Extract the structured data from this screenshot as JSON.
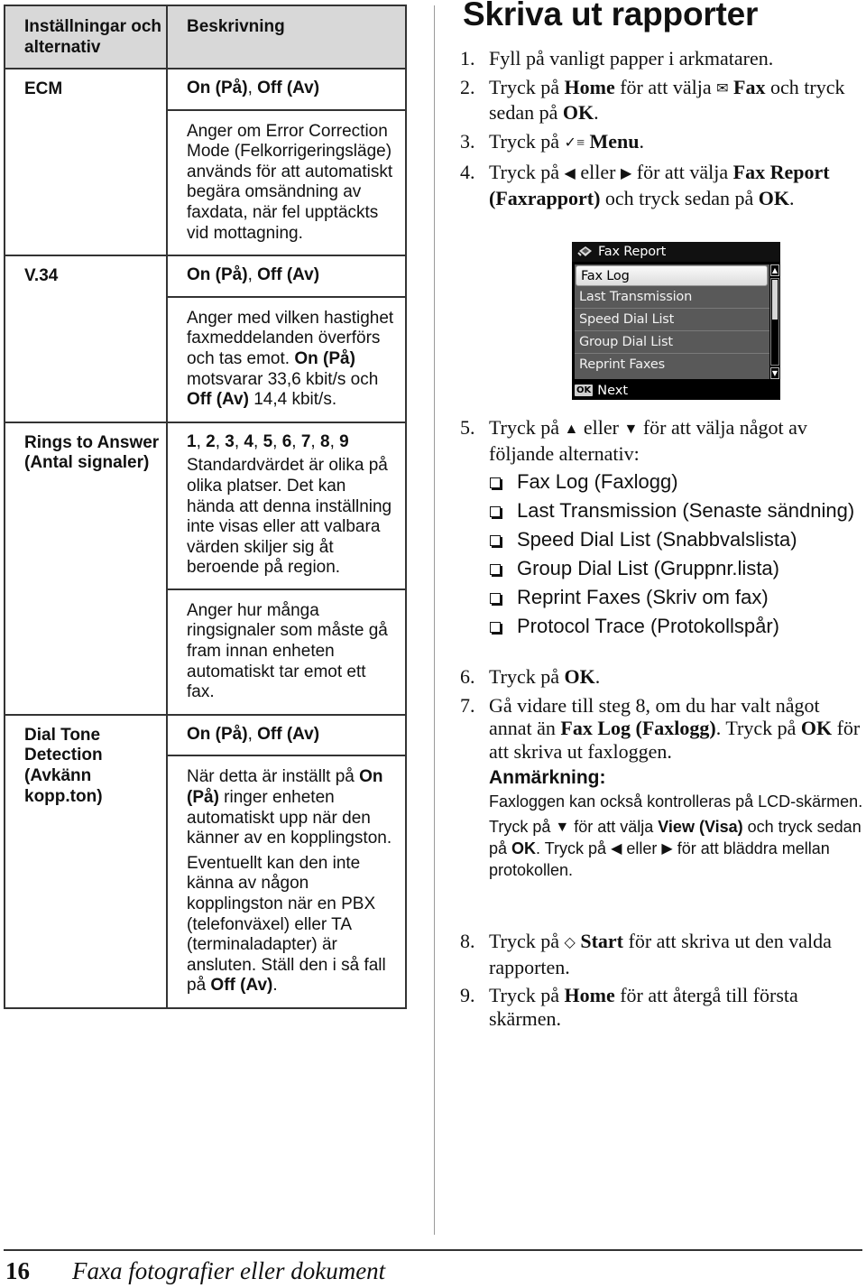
{
  "table": {
    "headers": [
      "Inställningar och alternativ",
      "Beskrivning"
    ],
    "rows": [
      {
        "setting": "ECM",
        "values_parts": [
          {
            "text": "On (På)",
            "bold": true
          },
          {
            "text": ", ",
            "bold": false
          },
          {
            "text": "Off (Av)",
            "bold": true
          }
        ],
        "description": [
          [
            {
              "text": "Anger om Error Correction Mode (Felkorrigeringsläge) används för att automatiskt begära omsändning av faxdata, när fel upptäckts vid mottagning.",
              "bold": false
            }
          ]
        ]
      },
      {
        "setting": "V.34",
        "values_parts": [
          {
            "text": "On (På)",
            "bold": true
          },
          {
            "text": ", ",
            "bold": false
          },
          {
            "text": "Off (Av)",
            "bold": true
          }
        ],
        "description": [
          [
            {
              "text": "Anger med vilken hastighet faxmeddelanden överförs och tas emot. ",
              "bold": false
            },
            {
              "text": "On (På)",
              "bold": true
            },
            {
              "text": " motsvarar 33,6 kbit/s och ",
              "bold": false
            },
            {
              "text": "Off (Av)",
              "bold": true
            },
            {
              "text": " 14,4 kbit/s.",
              "bold": false
            }
          ]
        ]
      },
      {
        "setting": "Rings to Answer (Antal signaler)",
        "values_parts": [
          {
            "text": "1",
            "bold": true
          },
          {
            "text": ", ",
            "bold": false
          },
          {
            "text": "2",
            "bold": true
          },
          {
            "text": ", ",
            "bold": false
          },
          {
            "text": "3",
            "bold": true
          },
          {
            "text": ", ",
            "bold": false
          },
          {
            "text": "4",
            "bold": true
          },
          {
            "text": ", ",
            "bold": false
          },
          {
            "text": "5",
            "bold": true
          },
          {
            "text": ", ",
            "bold": false
          },
          {
            "text": "6",
            "bold": true
          },
          {
            "text": ", ",
            "bold": false
          },
          {
            "text": "7",
            "bold": true
          },
          {
            "text": ", ",
            "bold": false
          },
          {
            "text": "8",
            "bold": true
          },
          {
            "text": ", ",
            "bold": false
          },
          {
            "text": "9",
            "bold": true
          }
        ],
        "values_note": "Standardvärdet är olika på olika platser. Det kan hända att denna inställning inte visas eller att valbara värden skiljer sig åt beroende på region.",
        "description": [
          [
            {
              "text": "Anger hur många ringsignaler som måste gå fram innan enheten automatiskt tar emot ett fax.",
              "bold": false
            }
          ]
        ]
      },
      {
        "setting": "Dial Tone Detection (Avkänn kopp.ton)",
        "values_parts": [
          {
            "text": "On (På)",
            "bold": true
          },
          {
            "text": ", ",
            "bold": false
          },
          {
            "text": "Off (Av)",
            "bold": true
          }
        ],
        "description": [
          [
            {
              "text": "När detta är inställt på ",
              "bold": false
            },
            {
              "text": "On (På)",
              "bold": true
            },
            {
              "text": " ringer enheten automatiskt upp när den känner av en kopplingston.",
              "bold": false
            }
          ],
          [
            {
              "text": "Eventuellt kan den inte känna av någon kopplingston när en PBX (telefonväxel) eller TA (terminaladapter) är ansluten. Ställ den i så fall på ",
              "bold": false
            },
            {
              "text": "Off (Av)",
              "bold": true
            },
            {
              "text": ".",
              "bold": false
            }
          ]
        ]
      }
    ]
  },
  "section": {
    "heading": "Skriva ut rapporter",
    "steps": [
      {
        "num": "1.",
        "parts": [
          {
            "text": "Fyll på vanligt papper i arkmataren.",
            "bold": false
          }
        ]
      },
      {
        "num": "2.",
        "parts": [
          {
            "text": "Tryck på ",
            "bold": false
          },
          {
            "text": "Home",
            "bold": true
          },
          {
            "text": " för att välja ",
            "bold": false
          },
          {
            "icon": "fax-icon"
          },
          {
            "text": " Fax",
            "bold": true
          },
          {
            "text": " och tryck sedan på ",
            "bold": false
          },
          {
            "text": "OK",
            "bold": true
          },
          {
            "text": ".",
            "bold": false
          }
        ]
      },
      {
        "num": "3.",
        "parts": [
          {
            "text": "Tryck på ",
            "bold": false
          },
          {
            "icon": "menu-icon"
          },
          {
            "text": " Menu",
            "bold": true
          },
          {
            "text": ".",
            "bold": false
          }
        ]
      },
      {
        "num": "4.",
        "parts": [
          {
            "text": "Tryck på ",
            "bold": false
          },
          {
            "icon": "left-arrow-icon"
          },
          {
            "text": " eller ",
            "bold": false
          },
          {
            "icon": "right-arrow-icon"
          },
          {
            "text": " för att välja ",
            "bold": false
          },
          {
            "text": "Fax Report (Faxrapport)",
            "bold": true
          },
          {
            "text": " och tryck sedan på ",
            "bold": false
          },
          {
            "text": "OK",
            "bold": true
          },
          {
            "text": ".",
            "bold": false
          }
        ]
      },
      {
        "num": "5.",
        "parts": [
          {
            "text": "Tryck på ",
            "bold": false
          },
          {
            "icon": "up-arrow-icon"
          },
          {
            "text": " eller ",
            "bold": false
          },
          {
            "icon": "down-arrow-icon"
          },
          {
            "text": " för att välja något av följande alternativ:",
            "bold": false
          }
        ]
      },
      {
        "num": "6.",
        "parts": [
          {
            "text": "Tryck på ",
            "bold": false
          },
          {
            "text": "OK",
            "bold": true
          },
          {
            "text": ".",
            "bold": false
          }
        ]
      },
      {
        "num": "7.",
        "parts": [
          {
            "text": "Gå vidare till steg 8, om du har valt något annat än ",
            "bold": false
          },
          {
            "text": "Fax Log (Faxlogg)",
            "bold": true
          },
          {
            "text": ". Tryck på ",
            "bold": false
          },
          {
            "text": "OK",
            "bold": true
          },
          {
            "text": " för att skriva ut faxloggen.",
            "bold": false
          }
        ]
      },
      {
        "num": "8.",
        "parts": [
          {
            "text": "Tryck på ",
            "bold": false
          },
          {
            "icon": "start-icon"
          },
          {
            "text": " Start",
            "bold": true
          },
          {
            "text": " för att skriva ut den valda rapporten.",
            "bold": false
          }
        ]
      },
      {
        "num": "9.",
        "parts": [
          {
            "text": "Tryck på ",
            "bold": false
          },
          {
            "text": "Home",
            "bold": true
          },
          {
            "text": " för att återgå till första skärmen.",
            "bold": false
          }
        ]
      }
    ],
    "options": [
      "Fax Log (Faxlogg)",
      "Last Transmission (Senaste sändning)",
      "Speed Dial List (Snabbvalslista)",
      "Group Dial List (Gruppnr.lista)",
      "Reprint Faxes (Skriv om fax)",
      "Protocol Trace (Protokollspår)"
    ],
    "note": {
      "title": "Anmärkning:",
      "paragraphs": [
        [
          {
            "text": "Faxloggen kan också kontrolleras på LCD-skärmen.",
            "bold": false
          }
        ],
        [
          {
            "text": "Tryck på ",
            "bold": false
          },
          {
            "icon": "down-arrow-icon"
          },
          {
            "text": " för att välja ",
            "bold": false
          },
          {
            "text": "View (Visa)",
            "bold": true
          },
          {
            "text": " och tryck sedan på ",
            "bold": false
          },
          {
            "text": "OK",
            "bold": true
          },
          {
            "text": ". Tryck på ",
            "bold": false
          },
          {
            "icon": "left-arrow-icon"
          },
          {
            "text": " eller ",
            "bold": false
          },
          {
            "icon": "right-arrow-icon"
          },
          {
            "text": " för att bläddra mellan protokollen.",
            "bold": false
          }
        ]
      ]
    }
  },
  "lcd": {
    "title": "Fax Report",
    "items": [
      "Fax Log",
      "Last Transmission",
      "Speed Dial List",
      "Group Dial List",
      "Reprint Faxes"
    ],
    "selected_index": 0,
    "ok_label": "OK",
    "footer_label": "Next",
    "scroll_up": "▲",
    "scroll_down": "▼"
  },
  "footer": {
    "page_number": "16",
    "title": "Faxa fotografier eller dokument"
  },
  "icons": {
    "left-arrow-icon": "◀",
    "right-arrow-icon": "▶",
    "up-arrow-icon": "▲",
    "down-arrow-icon": "▼",
    "start-icon": "◇",
    "menu-icon": "✓≡",
    "fax-icon": "✉"
  }
}
